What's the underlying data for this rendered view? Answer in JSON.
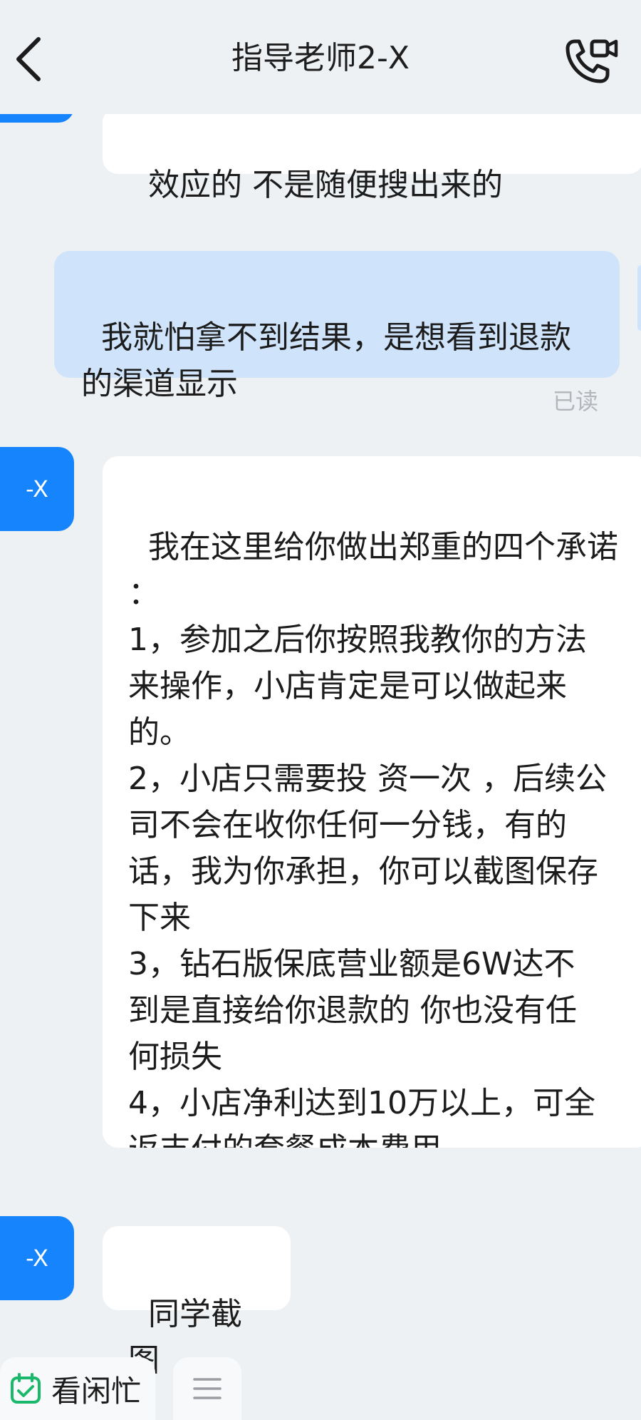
{
  "header": {
    "title": "指导老师2-X",
    "back_icon": "back-chevron-icon",
    "call_icon": "phone-video-call-icon"
  },
  "messages": [
    {
      "side": "in",
      "avatar_label": "",
      "text": "效应的 不是随便搜出来的"
    },
    {
      "side": "out",
      "text": "我就怕拿不到结果，是想看到退款\n的渠道显示",
      "status": "已读"
    },
    {
      "side": "in",
      "avatar_label": "-X",
      "text": "我在这里给你做出郑重的四个承诺\n：\n1，参加之后你按照我教你的方法\n来操作，小店肯定是可以做起来\n的。\n2，小店只需要投 资一次 ，后续公\n司不会在收你任何一分钱，有的\n话，我为你承担，你可以截图保存\n下来\n3，钻石版保底营业额是6W达不\n到是直接给你退款的 你也没有任\n何损失\n4，小店净利达到10万以上，可全\n返支付的套餐成本费用"
    },
    {
      "side": "in",
      "avatar_label": "-X",
      "text": "同学截图"
    }
  ],
  "bottom_bar": {
    "primary_label": "看闲忙",
    "primary_icon": "calendar-check-icon",
    "menu_icon": "menu-lines-icon",
    "accent_color": "#19b86b"
  },
  "colors": {
    "background": "#eef1f4",
    "avatar": "#1684fc",
    "incoming_bubble": "#ffffff",
    "outgoing_bubble": "#cfe4fb"
  }
}
